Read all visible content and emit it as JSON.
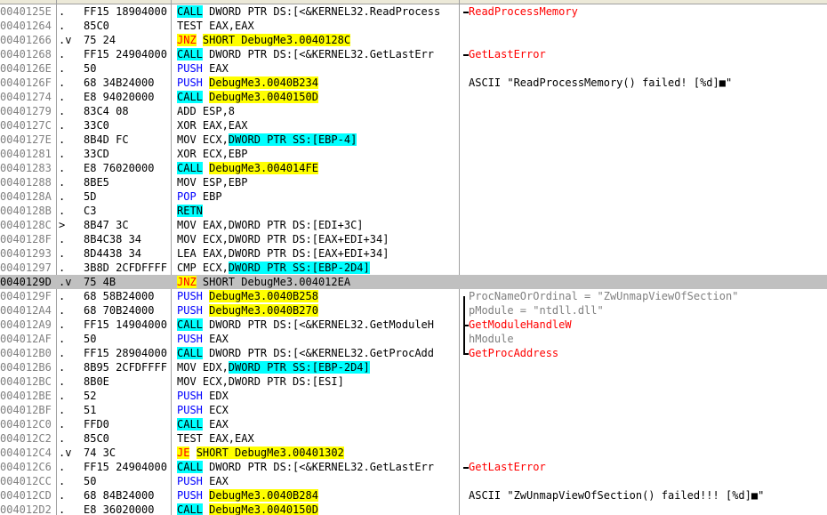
{
  "rows": [
    {
      "addr": "0040125E",
      "mark": ".",
      "hex": "FF15 18904000",
      "dis": [
        {
          "t": "CALL",
          "h": "c"
        },
        {
          "t": " DWORD PTR DS:[<&KERNEL32.ReadProcess"
        }
      ],
      "cmt": [
        {
          "t": "ReadProcessMemory",
          "red": true
        }
      ]
    },
    {
      "addr": "00401264",
      "mark": ".",
      "hex": "85C0",
      "dis": [
        {
          "t": "TEST EAX,EAX"
        }
      ],
      "cmt": []
    },
    {
      "addr": "00401266",
      "mark": ".v",
      "hex": "75 24",
      "dis": [
        {
          "t": "JNZ",
          "h": "y",
          "red": true
        },
        {
          "t": " "
        },
        {
          "t": "SHORT DebugMe3.0040128C",
          "h": "y"
        }
      ],
      "cmt": []
    },
    {
      "addr": "00401268",
      "mark": ".",
      "hex": "FF15 24904000",
      "dis": [
        {
          "t": "CALL",
          "h": "c"
        },
        {
          "t": " DWORD PTR DS:[<&KERNEL32.GetLastErr"
        }
      ],
      "cmt": [
        {
          "t": "GetLastError",
          "red": true
        }
      ]
    },
    {
      "addr": "0040126E",
      "mark": ".",
      "hex": "50",
      "dis": [
        {
          "t": "PUSH",
          "h": "c0"
        },
        {
          "t": " EAX"
        }
      ],
      "cmt": []
    },
    {
      "addr": "0040126F",
      "mark": ".",
      "hex": "68 34B24000",
      "dis": [
        {
          "t": "PUSH",
          "h": "c0"
        },
        {
          "t": " "
        },
        {
          "t": "DebugMe3.0040B234",
          "h": "y"
        }
      ],
      "cmt": [
        {
          "t": "ASCII \"ReadProcessMemory() failed! [%d]■\""
        }
      ]
    },
    {
      "addr": "00401274",
      "mark": ".",
      "hex": "E8 94020000",
      "dis": [
        {
          "t": "CALL",
          "h": "c"
        },
        {
          "t": " "
        },
        {
          "t": "DebugMe3.0040150D",
          "h": "y"
        }
      ],
      "cmt": []
    },
    {
      "addr": "00401279",
      "mark": ".",
      "hex": "83C4 08",
      "dis": [
        {
          "t": "ADD ESP,8"
        }
      ],
      "cmt": []
    },
    {
      "addr": "0040127C",
      "mark": ".",
      "hex": "33C0",
      "dis": [
        {
          "t": "XOR EAX,EAX"
        }
      ],
      "cmt": []
    },
    {
      "addr": "0040127E",
      "mark": ".",
      "hex": "8B4D FC",
      "dis": [
        {
          "t": "MOV ECX,"
        },
        {
          "t": "DWORD PTR SS:[EBP-4]",
          "h": "c"
        }
      ],
      "cmt": []
    },
    {
      "addr": "00401281",
      "mark": ".",
      "hex": "33CD",
      "dis": [
        {
          "t": "XOR ECX,EBP"
        }
      ],
      "cmt": []
    },
    {
      "addr": "00401283",
      "mark": ".",
      "hex": "E8 76020000",
      "dis": [
        {
          "t": "CALL",
          "h": "c"
        },
        {
          "t": " "
        },
        {
          "t": "DebugMe3.004014FE",
          "h": "y"
        }
      ],
      "cmt": []
    },
    {
      "addr": "00401288",
      "mark": ".",
      "hex": "8BE5",
      "dis": [
        {
          "t": "MOV ESP,EBP"
        }
      ],
      "cmt": []
    },
    {
      "addr": "0040128A",
      "mark": ".",
      "hex": "5D",
      "dis": [
        {
          "t": "POP",
          "h": "c0"
        },
        {
          "t": " EBP"
        }
      ],
      "cmt": []
    },
    {
      "addr": "0040128B",
      "mark": ".",
      "hex": "C3",
      "dis": [
        {
          "t": "RETN",
          "h": "c"
        }
      ],
      "cmt": []
    },
    {
      "addr": "0040128C",
      "mark": ">",
      "hex": "8B47 3C",
      "dis": [
        {
          "t": "MOV EAX,DWORD PTR DS:[EDI+3C]"
        }
      ],
      "cmt": []
    },
    {
      "addr": "0040128F",
      "mark": ".",
      "hex": "8B4C38 34",
      "dis": [
        {
          "t": "MOV ECX,DWORD PTR DS:[EAX+EDI+34]"
        }
      ],
      "cmt": []
    },
    {
      "addr": "00401293",
      "mark": ".",
      "hex": "8D4438 34",
      "dis": [
        {
          "t": "LEA EAX,DWORD PTR DS:[EAX+EDI+34]"
        }
      ],
      "cmt": []
    },
    {
      "addr": "00401297",
      "mark": ".",
      "hex": "3B8D 2CFDFFFF",
      "dis": [
        {
          "t": "CMP ECX,"
        },
        {
          "t": "DWORD PTR SS:[EBP-2D4]",
          "h": "c"
        }
      ],
      "cmt": []
    },
    {
      "addr": "0040129D",
      "mark": ".v",
      "hex": "75 4B",
      "sel": true,
      "dis": [
        {
          "t": "JNZ",
          "h": "y",
          "red": true
        },
        {
          "t": " SHORT DebugMe3.004012EA"
        }
      ],
      "cmt": []
    },
    {
      "addr": "0040129F",
      "mark": ".",
      "hex": "68 58B24000",
      "dis": [
        {
          "t": "PUSH",
          "h": "c0"
        },
        {
          "t": " "
        },
        {
          "t": "DebugMe3.0040B258",
          "h": "y"
        }
      ],
      "cmt": [
        {
          "t": "ProcNameOrOrdinal = \"ZwUnmapViewOfSection\"",
          "gray": true
        }
      ]
    },
    {
      "addr": "004012A4",
      "mark": ".",
      "hex": "68 70B24000",
      "dis": [
        {
          "t": "PUSH",
          "h": "c0"
        },
        {
          "t": " "
        },
        {
          "t": "DebugMe3.0040B270",
          "h": "y"
        }
      ],
      "cmt": [
        {
          "t": "pModule = \"ntdll.dll\"",
          "gray": true
        }
      ]
    },
    {
      "addr": "004012A9",
      "mark": ".",
      "hex": "FF15 14904000",
      "dis": [
        {
          "t": "CALL",
          "h": "c"
        },
        {
          "t": " DWORD PTR DS:[<&KERNEL32.GetModuleH"
        }
      ],
      "cmt": [
        {
          "t": "GetModuleHandleW",
          "red": true
        }
      ]
    },
    {
      "addr": "004012AF",
      "mark": ".",
      "hex": "50",
      "dis": [
        {
          "t": "PUSH",
          "h": "c0"
        },
        {
          "t": " EAX"
        }
      ],
      "cmt": [
        {
          "t": "hModule",
          "gray": true
        }
      ]
    },
    {
      "addr": "004012B0",
      "mark": ".",
      "hex": "FF15 28904000",
      "dis": [
        {
          "t": "CALL",
          "h": "c"
        },
        {
          "t": " DWORD PTR DS:[<&KERNEL32.GetProcAdd"
        }
      ],
      "cmt": [
        {
          "t": "GetProcAddress",
          "red": true
        }
      ]
    },
    {
      "addr": "004012B6",
      "mark": ".",
      "hex": "8B95 2CFDFFFF",
      "dis": [
        {
          "t": "MOV EDX,"
        },
        {
          "t": "DWORD PTR SS:[EBP-2D4]",
          "h": "c"
        }
      ],
      "cmt": []
    },
    {
      "addr": "004012BC",
      "mark": ".",
      "hex": "8B0E",
      "dis": [
        {
          "t": "MOV ECX,DWORD PTR DS:[ESI]"
        }
      ],
      "cmt": []
    },
    {
      "addr": "004012BE",
      "mark": ".",
      "hex": "52",
      "dis": [
        {
          "t": "PUSH",
          "h": "c0"
        },
        {
          "t": " EDX"
        }
      ],
      "cmt": []
    },
    {
      "addr": "004012BF",
      "mark": ".",
      "hex": "51",
      "dis": [
        {
          "t": "PUSH",
          "h": "c0"
        },
        {
          "t": " ECX"
        }
      ],
      "cmt": []
    },
    {
      "addr": "004012C0",
      "mark": ".",
      "hex": "FFD0",
      "dis": [
        {
          "t": "CALL",
          "h": "c"
        },
        {
          "t": " EAX"
        }
      ],
      "cmt": []
    },
    {
      "addr": "004012C2",
      "mark": ".",
      "hex": "85C0",
      "dis": [
        {
          "t": "TEST EAX,EAX"
        }
      ],
      "cmt": []
    },
    {
      "addr": "004012C4",
      "mark": ".v",
      "hex": "74 3C",
      "dis": [
        {
          "t": "JE",
          "h": "y",
          "red": true
        },
        {
          "t": " "
        },
        {
          "t": "SHORT DebugMe3.00401302",
          "h": "y"
        }
      ],
      "cmt": []
    },
    {
      "addr": "004012C6",
      "mark": ".",
      "hex": "FF15 24904000",
      "dis": [
        {
          "t": "CALL",
          "h": "c"
        },
        {
          "t": " DWORD PTR DS:[<&KERNEL32.GetLastErr"
        }
      ],
      "cmt": [
        {
          "t": "GetLastError",
          "red": true
        }
      ]
    },
    {
      "addr": "004012CC",
      "mark": ".",
      "hex": "50",
      "dis": [
        {
          "t": "PUSH",
          "h": "c0"
        },
        {
          "t": " EAX"
        }
      ],
      "cmt": []
    },
    {
      "addr": "004012CD",
      "mark": ".",
      "hex": "68 84B24000",
      "dis": [
        {
          "t": "PUSH",
          "h": "c0"
        },
        {
          "t": " "
        },
        {
          "t": "DebugMe3.0040B284",
          "h": "y"
        }
      ],
      "cmt": [
        {
          "t": "ASCII \"ZwUnmapViewOfSection() failed!!! [%d]■\""
        }
      ]
    },
    {
      "addr": "004012D2",
      "mark": ".",
      "hex": "E8 36020000",
      "dis": [
        {
          "t": "CALL",
          "h": "c"
        },
        {
          "t": " "
        },
        {
          "t": "DebugMe3.0040150D",
          "h": "y"
        }
      ],
      "cmt": []
    }
  ],
  "colors": {
    "call_bg": "#00ffff",
    "label_bg": "#ffff00",
    "api_text": "#ff0000",
    "push_text": "#0000ff",
    "selected_row": "#c0c0c0"
  }
}
